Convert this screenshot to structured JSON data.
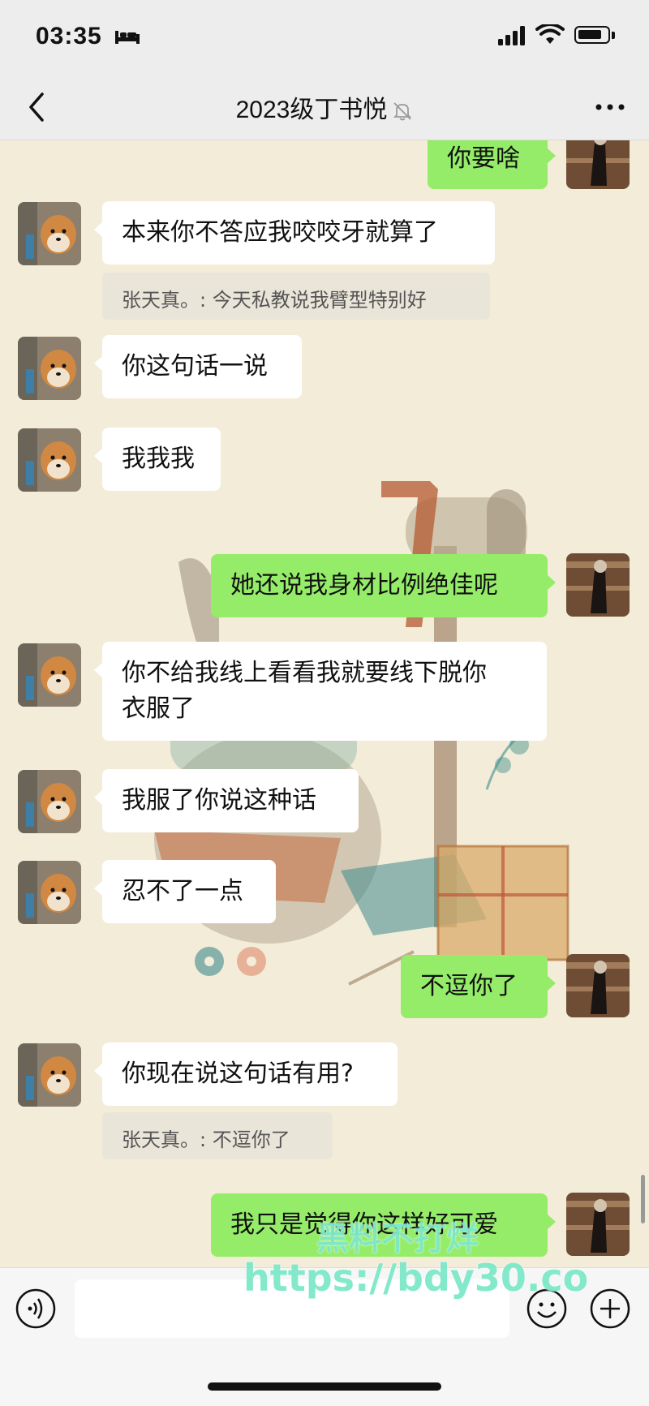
{
  "status_bar": {
    "time": "03:35"
  },
  "nav": {
    "title": "2023级丁书悦"
  },
  "messages": [
    {
      "text": "你要啥"
    },
    {
      "text": "本来你不答应我咬咬牙就算了"
    },
    {
      "text": "张天真。: 今天私教说我臂型特别好"
    },
    {
      "text": "你这句话一说"
    },
    {
      "text": "我我我"
    },
    {
      "text": "她还说我身材比例绝佳呢"
    },
    {
      "text": "你不给我线上看看我就要线下脱你\n衣服了"
    },
    {
      "text": "我服了你说这种话"
    },
    {
      "text": "忍不了一点"
    },
    {
      "text": "不逗你了"
    },
    {
      "text": "你现在说这句话有用?"
    },
    {
      "text": "张天真。: 不逗你了"
    },
    {
      "text": "我只是觉得你这样好可爱"
    }
  ],
  "watermark": {
    "line1": "黑料不打烊",
    "line2": "https://bdy30.co"
  },
  "colors": {
    "outgoing_bubble": "#95ec69",
    "incoming_bubble": "#ffffff",
    "chat_background": "#f3ecd9"
  }
}
